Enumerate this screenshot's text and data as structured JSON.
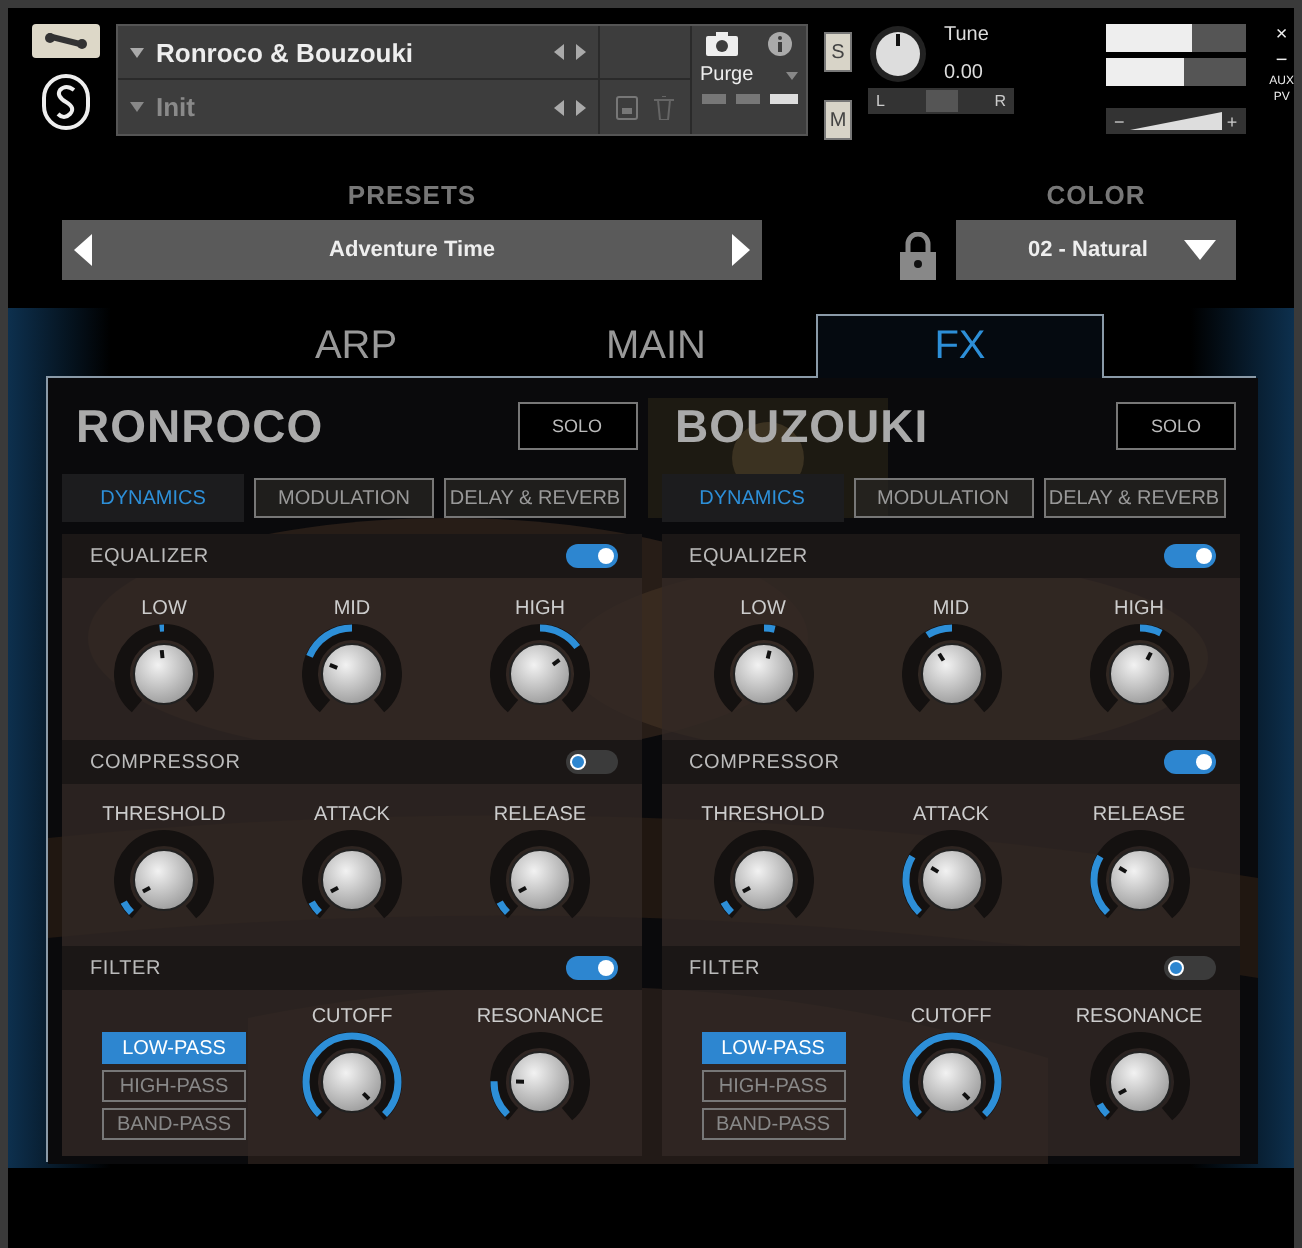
{
  "header": {
    "instrument": "Ronroco & Bouzouki",
    "snapshot": "Init",
    "purge": "Purge",
    "solo": "S",
    "mute": "M",
    "tune_label": "Tune",
    "tune_value": "0.00",
    "pan_left": "L",
    "pan_right": "R",
    "close": "×",
    "minimize": "−",
    "aux": "AUX",
    "pv": "PV",
    "volume_minus": "−",
    "volume_plus": "+",
    "pan": {
      "level": 0.5
    },
    "meters": [
      {
        "level": 0.62
      },
      {
        "level": 0.56
      }
    ]
  },
  "presets": {
    "label": "PRESETS",
    "value": "Adventure Time"
  },
  "color": {
    "label": "COLOR",
    "value": "02 - Natural"
  },
  "tabs": [
    {
      "label": "ARP",
      "selected": false
    },
    {
      "label": "MAIN",
      "selected": false
    },
    {
      "label": "FX",
      "selected": true
    }
  ],
  "panels": [
    {
      "title": "RONROCO",
      "solo": "SOLO",
      "subtabs": [
        {
          "label": "DYNAMICS",
          "selected": true
        },
        {
          "label": "MODULATION",
          "selected": false
        },
        {
          "label": "DELAY & REVERB",
          "selected": false
        }
      ],
      "sections": [
        {
          "kind": "eq",
          "title": "EQUALIZER",
          "on": true,
          "knobs": [
            {
              "label": "LOW"
            },
            {
              "label": "MID"
            },
            {
              "label": "HIGH"
            }
          ]
        },
        {
          "kind": "compressor",
          "title": "COMPRESSOR",
          "on": false,
          "knobs": [
            {
              "label": "THRESHOLD"
            },
            {
              "label": "ATTACK"
            },
            {
              "label": "RELEASE"
            }
          ]
        },
        {
          "kind": "filter",
          "title": "FILTER",
          "on": true,
          "modes": [
            {
              "label": "LOW-PASS",
              "selected": true
            },
            {
              "label": "HIGH-PASS",
              "selected": false
            },
            {
              "label": "BAND-PASS",
              "selected": false
            }
          ],
          "knobs": [
            {
              "label": "CUTOFF"
            },
            {
              "label": "RESONANCE"
            }
          ]
        }
      ]
    },
    {
      "title": "BOUZOUKI",
      "solo": "SOLO",
      "subtabs": [
        {
          "label": "DYNAMICS",
          "selected": true
        },
        {
          "label": "MODULATION",
          "selected": false
        },
        {
          "label": "DELAY & REVERB",
          "selected": false
        }
      ],
      "sections": [
        {
          "kind": "eq",
          "title": "EQUALIZER",
          "on": true,
          "knobs": [
            {
              "label": "LOW"
            },
            {
              "label": "MID"
            },
            {
              "label": "HIGH"
            }
          ]
        },
        {
          "kind": "compressor",
          "title": "COMPRESSOR",
          "on": true,
          "knobs": [
            {
              "label": "THRESHOLD"
            },
            {
              "label": "ATTACK"
            },
            {
              "label": "RELEASE"
            }
          ]
        },
        {
          "kind": "filter",
          "title": "FILTER",
          "on": false,
          "modes": [
            {
              "label": "LOW-PASS",
              "selected": true
            },
            {
              "label": "HIGH-PASS",
              "selected": false
            },
            {
              "label": "BAND-PASS",
              "selected": false
            }
          ],
          "knobs": [
            {
              "label": "CUTOFF"
            },
            {
              "label": "RESONANCE"
            }
          ]
        }
      ]
    }
  ]
}
